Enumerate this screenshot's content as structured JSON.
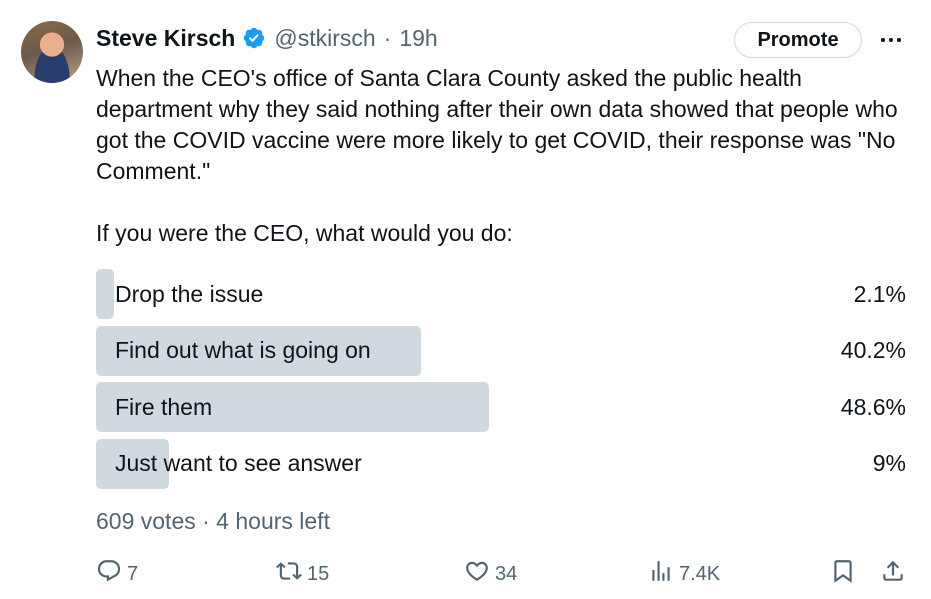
{
  "author": {
    "name": "Steve Kirsch",
    "handle": "@stkirsch",
    "separator": "·",
    "time": "19h"
  },
  "promote_label": "Promote",
  "tweet_text": "When the CEO's office of Santa Clara County asked the public health department why they said nothing after their own data showed that people who got the COVID vaccine were more likely to get COVID, their response was \"No Comment.\"\n\nIf you were the CEO, what would you do:",
  "poll": {
    "options": [
      {
        "label": "Drop the issue",
        "percent": "2.1%",
        "value": 2.1
      },
      {
        "label": "Find out what is going on",
        "percent": "40.2%",
        "value": 40.2
      },
      {
        "label": "Fire them",
        "percent": "48.6%",
        "value": 48.6
      },
      {
        "label": "Just want to see answer",
        "percent": "9%",
        "value": 9
      }
    ],
    "meta": "609 votes · 4 hours left"
  },
  "actions": {
    "reply_count": "7",
    "retweet_count": "15",
    "like_count": "34",
    "views_count": "7.4K"
  },
  "icons": {
    "verified": "verified-badge-icon",
    "more": "more-dots-icon",
    "reply": "reply-icon",
    "retweet": "retweet-icon",
    "like": "heart-icon",
    "views": "views-chart-icon",
    "bookmark": "bookmark-icon",
    "share": "share-icon"
  },
  "colors": {
    "text": "#0f1419",
    "secondary": "#536471",
    "poll_bar": "#cfd9de",
    "verified": "#1d9bf0"
  }
}
